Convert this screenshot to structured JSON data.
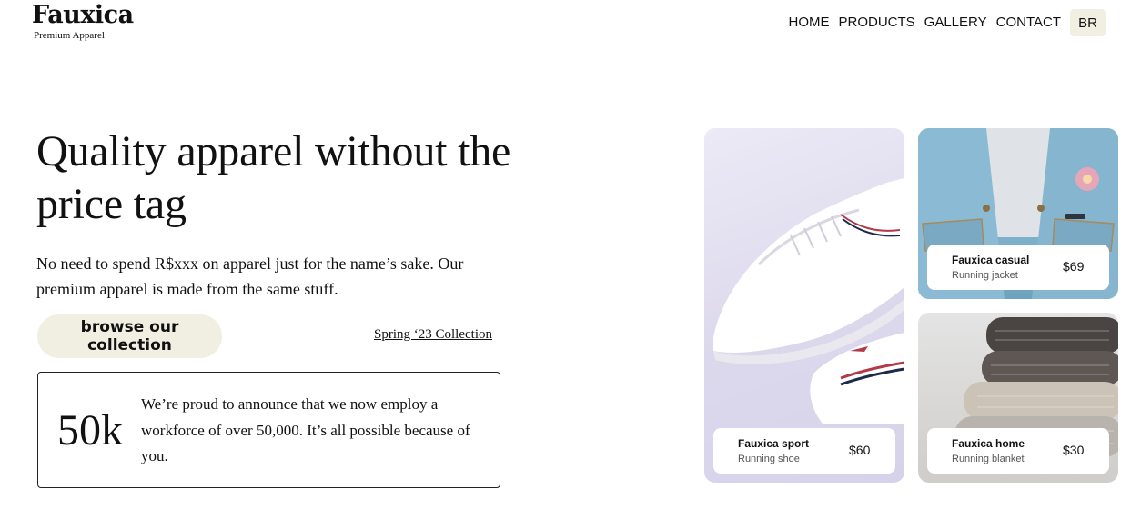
{
  "brand": {
    "name": "Fauxica",
    "tagline": "Premium Apparel"
  },
  "nav": {
    "items": [
      {
        "label": "HOME"
      },
      {
        "label": "PRODUCTS"
      },
      {
        "label": "GALLERY"
      },
      {
        "label": "CONTACT"
      }
    ],
    "language": "BR"
  },
  "hero": {
    "title": "Quality apparel without the price tag",
    "description": "No need to spend R$xxx on apparel just for the name’s sake. Our premium apparel is made from the same stuff.",
    "cta_label": "browse our collection",
    "collection_link": "Spring ‘23 Collection"
  },
  "announcement": {
    "number": "50k",
    "text": "We’re proud to announce that we now employ a workforce of over 50,000. It’s all possible because of you."
  },
  "products": [
    {
      "name": "Fauxica sport",
      "subtitle": "Running shoe",
      "price": "$60",
      "icon": "sneaker-image"
    },
    {
      "name": "Fauxica casual",
      "subtitle": "Running jacket",
      "price": "$69",
      "icon": "denim-jacket-image"
    },
    {
      "name": "Fauxica home",
      "subtitle": "Running blanket",
      "price": "$30",
      "icon": "folded-sweaters-image"
    }
  ],
  "colors": {
    "accent": "#f1efe2",
    "text": "#111111",
    "border": "#222222"
  }
}
